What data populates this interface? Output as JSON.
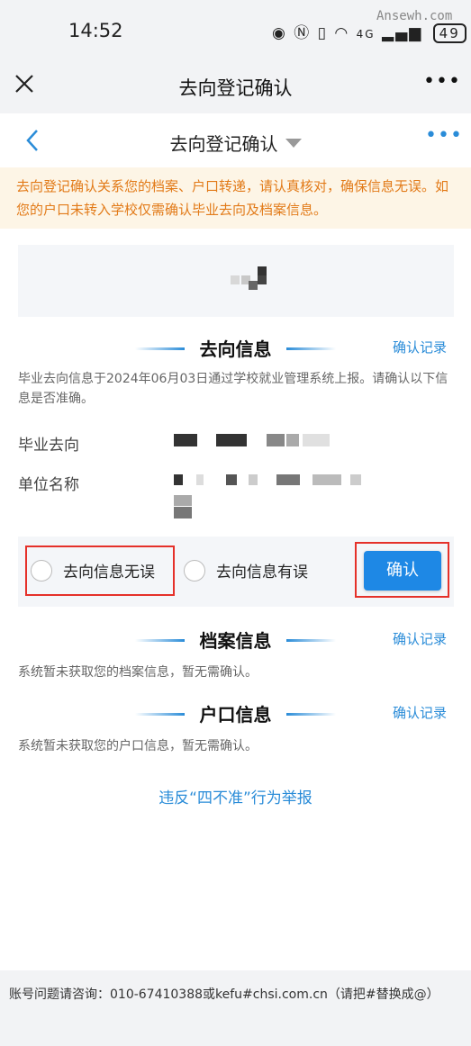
{
  "status_bar": {
    "time": "14:52",
    "network": "4G",
    "battery": "49",
    "watermark": "Ansewh.com"
  },
  "app_bar": {
    "title": "去向登记确认",
    "close_icon": "close-icon",
    "more_icon": "more-icon"
  },
  "nav_bar": {
    "title": "去向登记确认",
    "back_icon": "chevron-left-icon",
    "more_icon": "more-icon"
  },
  "notice": {
    "text": "去向登记确认关系您的档案、户口转递，请认真核对，确保信息无误。如您的户口未转入学校仅需确认毕业去向及档案信息。"
  },
  "destination_section": {
    "title": "去向信息",
    "record_link": "确认记录",
    "description": "毕业去向信息于2024年06月03日通过学校就业管理系统上报。请确认以下信息是否准确。",
    "fields": [
      {
        "label": "毕业去向",
        "value": ""
      },
      {
        "label": "单位名称",
        "value": ""
      }
    ],
    "options": [
      {
        "label": "去向信息无误",
        "selected": false
      },
      {
        "label": "去向信息有误",
        "selected": false
      }
    ],
    "confirm_button": "确认"
  },
  "archive_section": {
    "title": "档案信息",
    "record_link": "确认记录",
    "description": "系统暂未获取您的档案信息，暂无需确认。"
  },
  "hukou_section": {
    "title": "户口信息",
    "record_link": "确认记录",
    "description": "系统暂未获取您的户口信息，暂无需确认。"
  },
  "report_link": "违反“四不准”行为举报",
  "footer": {
    "text": "账号问题请咨询：010-67410388或kefu#chsi.com.cn（请把#替换成@）"
  },
  "colors": {
    "accent": "#2a8cd8",
    "button": "#1e88e5",
    "notice_text": "#e27a18",
    "notice_bg": "#fdf5e6",
    "highlight": "#e5312a"
  }
}
